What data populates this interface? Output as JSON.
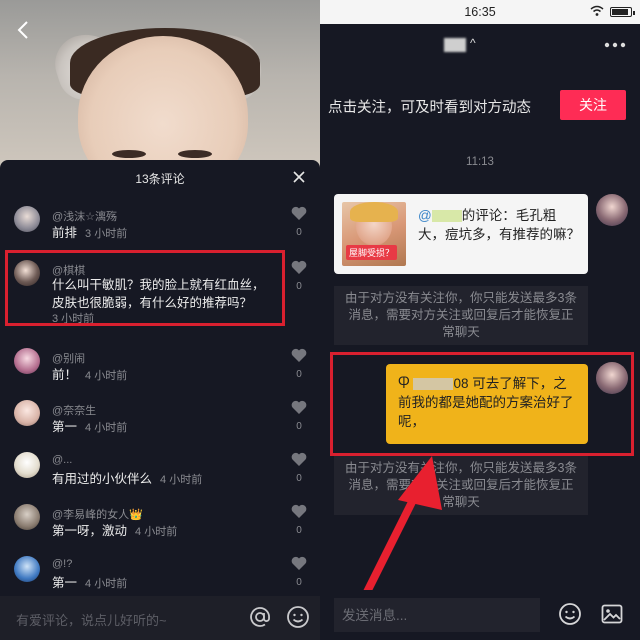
{
  "left": {
    "comment_count_title": "13条评论",
    "comments": [
      {
        "user": "@浅沫☆漓殇",
        "text": "前排",
        "time": "3 小时前",
        "likes": "0"
      },
      {
        "user": "@棋棋",
        "text_line1": "什么叫干敏肌？我的脸上就有红血丝，",
        "text_line2": "皮肤也很脆弱，有什么好的推荐吗？",
        "time": "3 小时前",
        "likes": "0"
      },
      {
        "user": "@别闹",
        "text": "前！",
        "time": "4 小时前",
        "likes": "0"
      },
      {
        "user": "@奈奈生",
        "text": "第一",
        "time": "4 小时前",
        "likes": "0"
      },
      {
        "user": "@...",
        "text": "有用过的小伙伴么",
        "time": "4 小时前",
        "likes": "0"
      },
      {
        "user": "@李易峰的女人👑",
        "text": "第一呀，激动",
        "time": "4 小时前",
        "likes": "0"
      },
      {
        "user": "@!?",
        "text": "第一",
        "time": "4 小时前",
        "likes": "0"
      }
    ],
    "input_placeholder": "有爱评论，说点儿好听的~",
    "colors": {
      "sheet_bg": "#161823",
      "highlight": "#d9202f"
    }
  },
  "right": {
    "status_time": "16:35",
    "chat_name_caret": "^",
    "follow_prompt": "点击关注，可及时看到对方动态",
    "follow_button": "关注",
    "timestamp": "11:13",
    "shared_comment": {
      "prefix": "@",
      "suffix": "的评论：毛孔粗大，痘坑多，有推荐的嘛？",
      "thumb_tag": "屋脚受损？"
    },
    "system_message": "由于对方没有关注你，你只能发送最多3条消息，需要对方关注或回复后才能恢复正常聊天",
    "my_message": {
      "prefix": "Ⴔ",
      "num": "08",
      "text": "可去了解下，之前我的都是她配的方案治好了呢，"
    },
    "input_placeholder": "发送消息...",
    "colors": {
      "follow": "#fe2c55",
      "bubble": "#f0b31a",
      "highlight": "#d9202f"
    }
  }
}
